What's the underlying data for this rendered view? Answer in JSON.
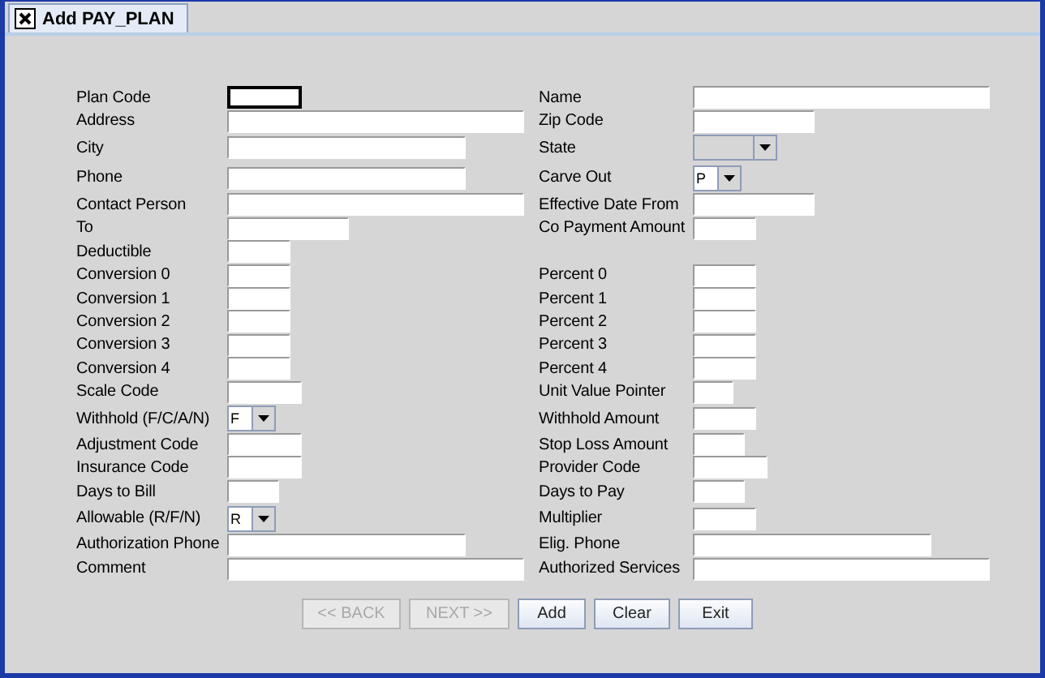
{
  "window": {
    "tab": {
      "title": "Add PAY_PLAN",
      "selected": true
    }
  },
  "rows": [
    {
      "left": {
        "kind": "text",
        "label": "Plan Code",
        "focused": true
      },
      "right": {
        "kind": "text",
        "label": "Name",
        "focused": false
      }
    },
    {
      "left": {
        "kind": "text",
        "label": "Address",
        "focused": false
      },
      "right": {
        "kind": "text",
        "label": "Zip Code",
        "focused": false
      }
    },
    {
      "left": {
        "kind": "text",
        "label": "City",
        "focused": false
      },
      "right": {
        "kind": "combo",
        "label": "State"
      }
    },
    {
      "left": {
        "kind": "text",
        "label": "Phone",
        "focused": false
      },
      "right": {
        "kind": "combo",
        "label": "Carve Out",
        "value": "P"
      }
    },
    {
      "left": {
        "kind": "text",
        "label": "Contact Person",
        "focused": false
      },
      "right": {
        "kind": "text",
        "label": "Effective Date From",
        "focused": false
      }
    },
    {
      "left": {
        "kind": "text",
        "label": "To",
        "focused": false
      },
      "right": {
        "kind": "text",
        "label": "Co Payment Amount",
        "focused": false
      }
    },
    {
      "left": {
        "kind": "text",
        "label": "Deductible",
        "focused": false
      }
    },
    {
      "left": {
        "kind": "text",
        "label": "Conversion 0",
        "focused": false
      },
      "right": {
        "kind": "text",
        "label": "Percent 0",
        "focused": false
      }
    },
    {
      "left": {
        "kind": "text",
        "label": "Conversion 1",
        "focused": false
      },
      "right": {
        "kind": "text",
        "label": "Percent 1",
        "focused": false
      }
    },
    {
      "left": {
        "kind": "text",
        "label": "Conversion 2",
        "focused": false
      },
      "right": {
        "kind": "text",
        "label": "Percent 2",
        "focused": false
      }
    },
    {
      "left": {
        "kind": "text",
        "label": "Conversion 3",
        "focused": false
      },
      "right": {
        "kind": "text",
        "label": "Percent 3",
        "focused": false
      }
    },
    {
      "left": {
        "kind": "text",
        "label": "Conversion 4",
        "focused": false
      },
      "right": {
        "kind": "text",
        "label": "Percent 4",
        "focused": false
      }
    },
    {
      "left": {
        "kind": "text",
        "label": "Scale Code",
        "focused": false
      },
      "right": {
        "kind": "text",
        "label": "Unit Value Pointer",
        "focused": false
      }
    },
    {
      "left": {
        "kind": "combo",
        "label": "Withhold (F/C/A/N)",
        "value": "F"
      },
      "right": {
        "kind": "text",
        "label": "Withhold Amount",
        "focused": false
      }
    },
    {
      "left": {
        "kind": "text",
        "label": "Adjustment Code",
        "focused": false
      },
      "right": {
        "kind": "text",
        "label": "Stop Loss Amount",
        "focused": false
      }
    },
    {
      "left": {
        "kind": "text",
        "label": "Insurance Code",
        "focused": false
      },
      "right": {
        "kind": "text",
        "label": "Provider Code",
        "focused": false
      }
    },
    {
      "left": {
        "kind": "text",
        "label": "Days to Bill",
        "focused": false
      },
      "right": {
        "kind": "text",
        "label": "Days to Pay",
        "focused": false
      }
    },
    {
      "left": {
        "kind": "combo",
        "label": "Allowable (R/F/N)",
        "value": "R"
      },
      "right": {
        "kind": "text",
        "label": "Multiplier",
        "focused": false
      }
    },
    {
      "left": {
        "kind": "text",
        "label": "Authorization Phone",
        "focused": false
      },
      "right": {
        "kind": "text",
        "label": "Elig. Phone",
        "focused": false
      }
    },
    {
      "left": {
        "kind": "text",
        "label": "Comment",
        "focused": false
      },
      "right": {
        "kind": "text",
        "label": "Authorized Services",
        "focused": false
      }
    }
  ],
  "buttons": [
    {
      "label": "<< BACK",
      "disabled": true
    },
    {
      "label": "NEXT >>",
      "disabled": true
    },
    {
      "label": "Add",
      "disabled": false
    },
    {
      "label": "Clear",
      "disabled": false
    },
    {
      "label": "Exit",
      "disabled": false
    }
  ]
}
